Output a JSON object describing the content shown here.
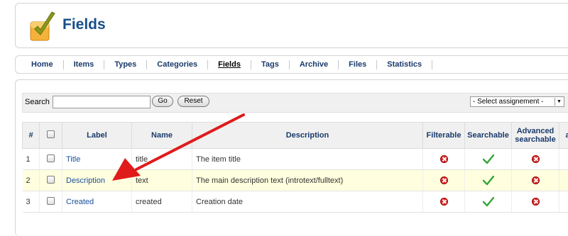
{
  "header": {
    "title": "Fields",
    "logo_icon": "checkmark-logo-icon"
  },
  "nav": {
    "items": [
      {
        "label": "Home"
      },
      {
        "label": "Items"
      },
      {
        "label": "Types"
      },
      {
        "label": "Categories"
      },
      {
        "label": "Fields",
        "active": true
      },
      {
        "label": "Tags"
      },
      {
        "label": "Archive"
      },
      {
        "label": "Files"
      },
      {
        "label": "Statistics"
      }
    ]
  },
  "filter": {
    "search_label": "Search",
    "search_value": "",
    "go_label": "Go",
    "reset_label": "Reset",
    "assignment_select": "- Select assignement -"
  },
  "table": {
    "columns": {
      "num": "#",
      "label": "Label",
      "name": "Name",
      "description": "Description",
      "filterable": "Filterable",
      "searchable": "Searchable",
      "advanced_searchable": "Advanced searchable",
      "extra": "a"
    },
    "rows": [
      {
        "num": "1",
        "label": "Title",
        "name": "title",
        "description": "The item title",
        "filterable": "no",
        "searchable": "yes",
        "advanced_searchable": "no"
      },
      {
        "num": "2",
        "label": "Description",
        "name": "text",
        "description": "The main description text (introtext/fulltext)",
        "filterable": "no",
        "searchable": "yes",
        "advanced_searchable": "no"
      },
      {
        "num": "3",
        "label": "Created",
        "name": "created",
        "description": "Creation date",
        "filterable": "no",
        "searchable": "yes",
        "advanced_searchable": "no"
      }
    ]
  },
  "colors": {
    "accent": "#164f8a",
    "highlight_row": "#ffffdf",
    "annotation_arrow": "#e01b1b",
    "cross": "#d42a2a",
    "check": "#3aa63a"
  }
}
